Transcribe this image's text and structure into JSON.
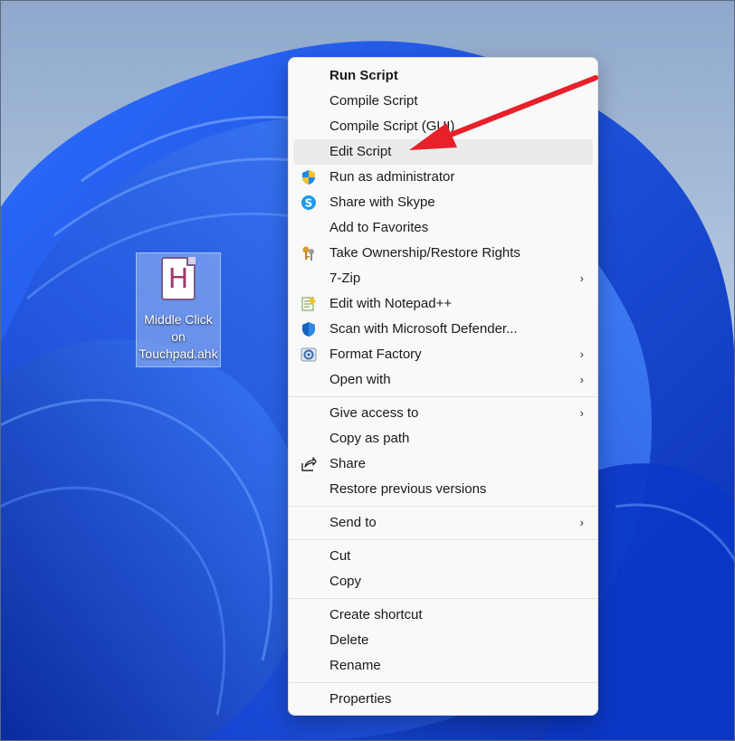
{
  "desktop_icon": {
    "glyph": "H",
    "label": "Middle Click\non\nTouchpad.ahk"
  },
  "context_menu": {
    "groups": [
      [
        {
          "label": "Run Script",
          "bold": true
        },
        {
          "label": "Compile Script"
        },
        {
          "label": "Compile Script (GUI)"
        },
        {
          "label": "Edit Script",
          "highlighted": true
        },
        {
          "label": "Run as administrator",
          "icon": "uac-shield-icon"
        },
        {
          "label": "Share with Skype",
          "icon": "skype-icon"
        },
        {
          "label": "Add to Favorites"
        },
        {
          "label": "Take Ownership/Restore Rights",
          "icon": "keys-icon"
        },
        {
          "label": "7-Zip",
          "submenu": true
        },
        {
          "label": "Edit with Notepad++",
          "icon": "notepad-plus-plus-icon"
        },
        {
          "label": "Scan with Microsoft Defender...",
          "icon": "defender-shield-icon"
        },
        {
          "label": "Format Factory",
          "icon": "format-factory-icon",
          "submenu": true
        },
        {
          "label": "Open with",
          "submenu": true
        }
      ],
      [
        {
          "label": "Give access to",
          "submenu": true
        },
        {
          "label": "Copy as path"
        },
        {
          "label": "Share",
          "icon": "share-icon"
        },
        {
          "label": "Restore previous versions"
        }
      ],
      [
        {
          "label": "Send to",
          "submenu": true
        }
      ],
      [
        {
          "label": "Cut"
        },
        {
          "label": "Copy"
        }
      ],
      [
        {
          "label": "Create shortcut"
        },
        {
          "label": "Delete"
        },
        {
          "label": "Rename"
        }
      ],
      [
        {
          "label": "Properties"
        }
      ]
    ],
    "submenu_glyph": "›"
  },
  "colors": {
    "annotation_arrow": "#e8202a",
    "menu_background": "#f9f9f9",
    "highlight": "#ebebeb",
    "wallpaper_blue": "#1650e8"
  }
}
